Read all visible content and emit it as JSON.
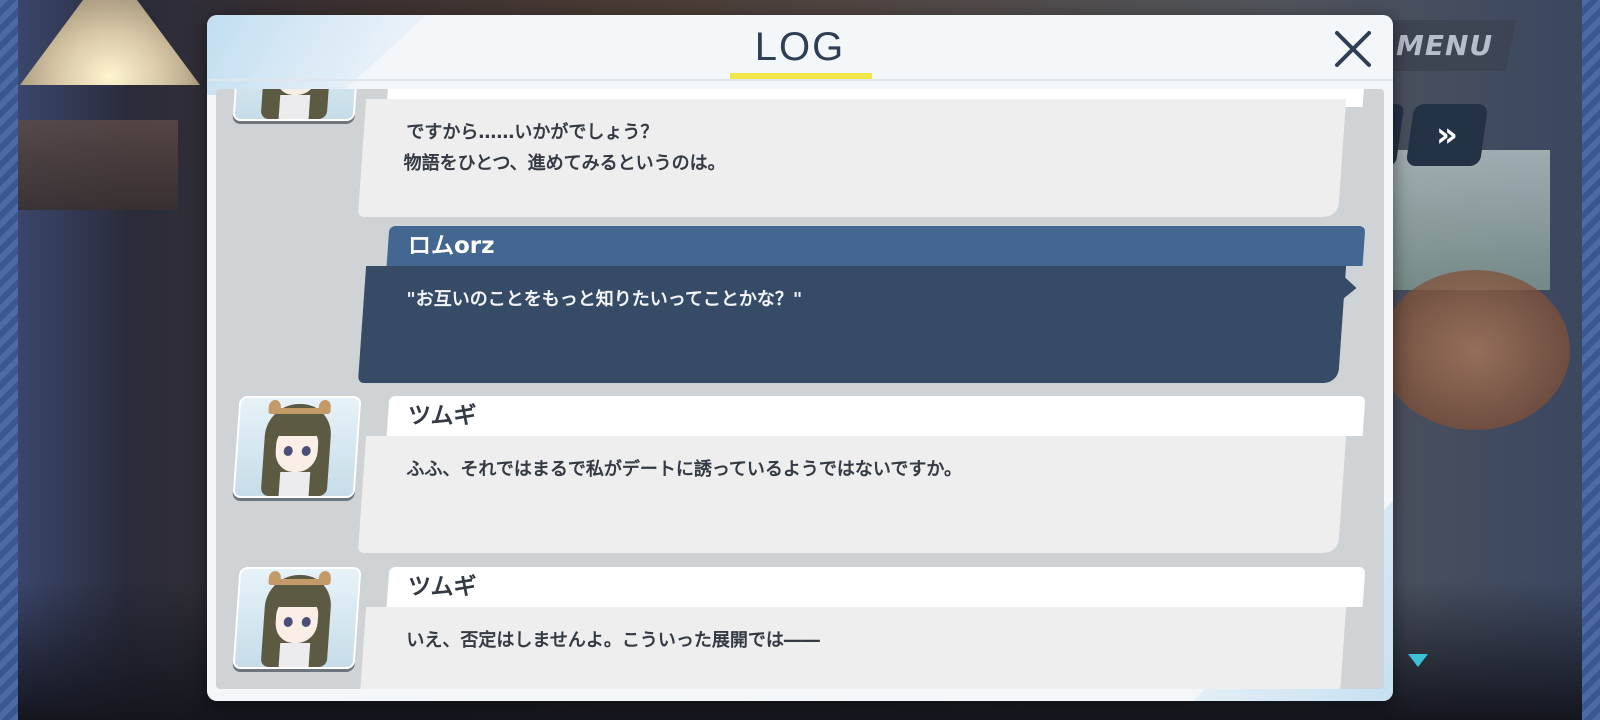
{
  "hud": {
    "menu_label": "MENU",
    "fast_forward_glyph": "»"
  },
  "log_dialog": {
    "title": "LOG",
    "close_icon": "close-icon",
    "entries": [
      {
        "speaker": "",
        "lines": [
          "ですから……いかがでしょう？",
          "物語をひとつ、進めてみるというのは。"
        ]
      },
      {
        "speaker": "ロムorz",
        "lines": [
          "\"お互いのことをもっと知りたいってことかな？\""
        ]
      },
      {
        "speaker": "ツムギ",
        "lines": [
          "ふふ、それではまるで私がデートに誘っているようではないですか。"
        ]
      },
      {
        "speaker": "ツムギ",
        "lines": [
          "いえ、否定はしませんよ。こういった展開では――"
        ]
      }
    ]
  },
  "colors": {
    "accent_underline": "#f2e64a",
    "player_name_bar": "#436790",
    "player_text_box": "#364b66",
    "indicator": "#3ec0d8"
  }
}
